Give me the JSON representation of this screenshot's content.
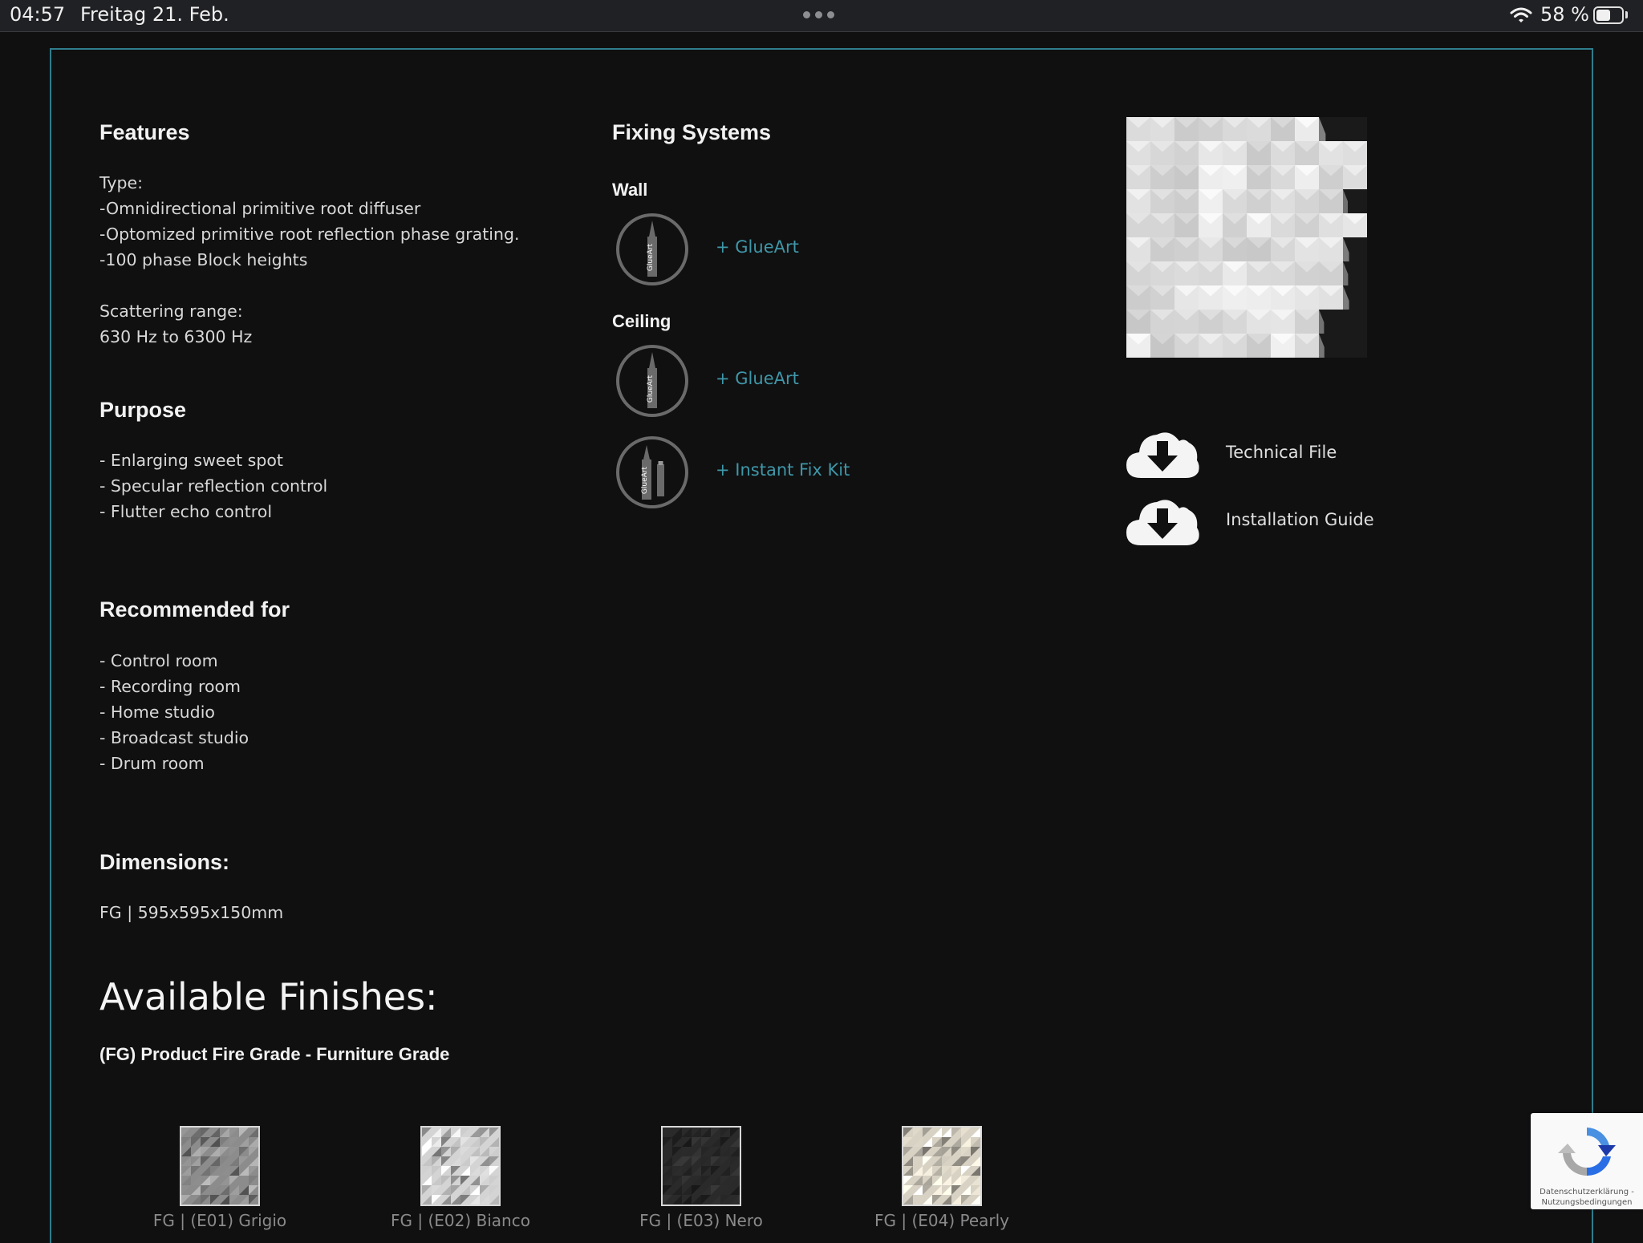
{
  "status_bar": {
    "time": "04:57",
    "date": "Freitag 21. Feb.",
    "battery": "58 %",
    "battery_level": 0.58
  },
  "features": {
    "title": "Features",
    "lines": [
      "Type:",
      "-Omnidirectional primitive root diffuser",
      "-Optomized primitive root reflection phase grating.",
      "-100 phase Block heights",
      "",
      "Scattering range:",
      "630 Hz to 6300 Hz"
    ]
  },
  "purpose": {
    "title": "Purpose",
    "lines": [
      "- Enlarging sweet spot",
      "- Specular reflection control",
      "- Flutter echo control"
    ]
  },
  "recommended": {
    "title": "Recommended for",
    "lines": [
      "- Control room",
      "- Recording room",
      "- Home studio",
      "- Broadcast studio",
      "- Drum room"
    ]
  },
  "dimensions": {
    "title": "Dimensions:",
    "value": "FG | 595x595x150mm"
  },
  "fixing": {
    "title": "Fixing Systems",
    "wall_label": "Wall",
    "ceiling_label": "Ceiling",
    "wall_link": "+ GlueArt",
    "ceiling_link_1": "+ GlueArt",
    "ceiling_link_2": "+ Instant Fix Kit",
    "icon_text": "GlueArt"
  },
  "downloads": {
    "technical": "Technical File",
    "installation": "Installation Guide"
  },
  "finishes": {
    "heading": "Available Finishes:",
    "subheading": "(FG) Product Fire Grade - Furniture Grade",
    "items": [
      {
        "label": "FG | (E01) Grigio",
        "color": "#8c8c8c"
      },
      {
        "label": "FG | (E02) Bianco",
        "color": "#d4d4d4"
      },
      {
        "label": "FG | (E03) Nero",
        "color": "#2a2a2a"
      },
      {
        "label": "FG | (E04) Pearly",
        "color": "#d8d2c4"
      }
    ]
  },
  "recaptcha": {
    "line1": "Datenschutzerklärung -",
    "line2": "Nutzungsbedingungen"
  },
  "colors": {
    "accent": "#3f97a8",
    "frame": "#2f7d8c",
    "background": "#101011"
  }
}
